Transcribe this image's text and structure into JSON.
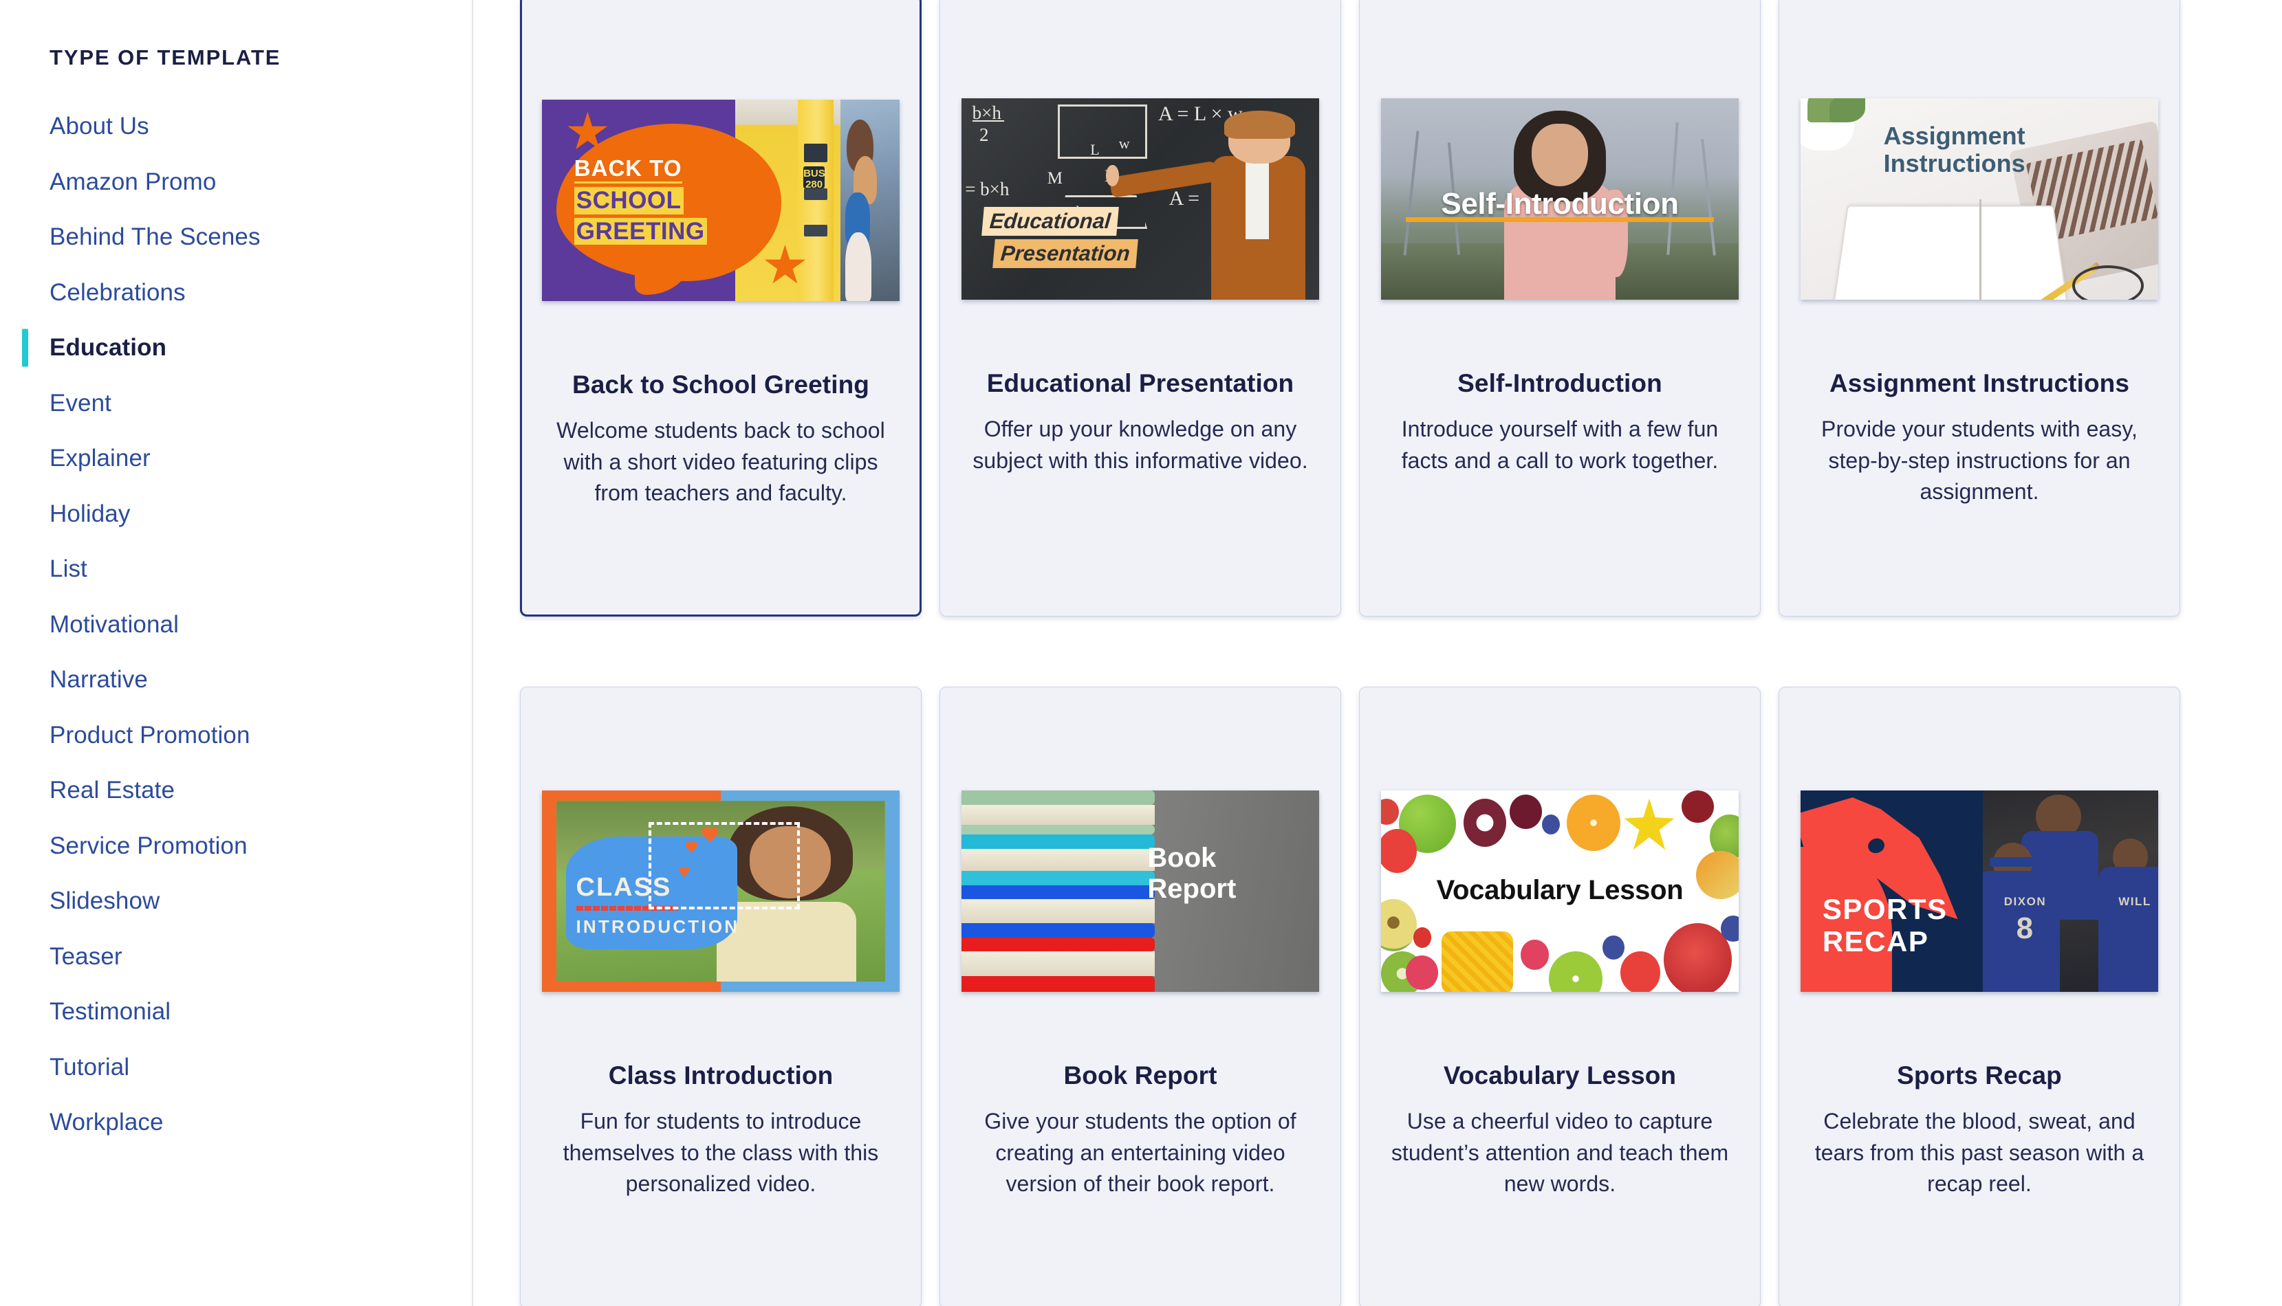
{
  "sidebar": {
    "title": "TYPE OF TEMPLATE",
    "items": [
      {
        "label": "About Us",
        "active": false
      },
      {
        "label": "Amazon Promo",
        "active": false
      },
      {
        "label": "Behind The Scenes",
        "active": false
      },
      {
        "label": "Celebrations",
        "active": false
      },
      {
        "label": "Education",
        "active": true
      },
      {
        "label": "Event",
        "active": false
      },
      {
        "label": "Explainer",
        "active": false
      },
      {
        "label": "Holiday",
        "active": false
      },
      {
        "label": "List",
        "active": false
      },
      {
        "label": "Motivational",
        "active": false
      },
      {
        "label": "Narrative",
        "active": false
      },
      {
        "label": "Product Promotion",
        "active": false
      },
      {
        "label": "Real Estate",
        "active": false
      },
      {
        "label": "Service Promotion",
        "active": false
      },
      {
        "label": "Slideshow",
        "active": false
      },
      {
        "label": "Teaser",
        "active": false
      },
      {
        "label": "Testimonial",
        "active": false
      },
      {
        "label": "Tutorial",
        "active": false
      },
      {
        "label": "Workplace",
        "active": false
      }
    ]
  },
  "colors": {
    "accent_teal": "#23c8d2",
    "link_blue": "#2c4b9b",
    "heading_navy": "#1b1f45",
    "card_bg": "#f0f2f8",
    "card_border": "#ccd3e8",
    "card_border_selected": "#24337e",
    "page_bg": "#ffffff"
  },
  "templates": [
    {
      "title": "Back to School Greeting",
      "description": "Welcome students back to school with a short video featuring clips from teachers and faculty.",
      "selected": true,
      "thumbnail_text": {
        "line1": "BACK TO",
        "line2": "SCHOOL",
        "line3": "GREETING",
        "bus_label": "BUS",
        "bus_number": "280"
      }
    },
    {
      "title": "Educational Presentation",
      "description": "Offer up your knowledge on any subject with this informative video.",
      "selected": false,
      "thumbnail_text": {
        "line1": "Educational",
        "line2": "Presentation",
        "chalk": [
          "b×h",
          "2",
          "= b×h",
          "M",
          "B",
          "E",
          "L",
          "w",
          "h",
          "A = L × w",
          "A ="
        ]
      }
    },
    {
      "title": "Self-Introduction",
      "description": "Introduce yourself with a few fun facts and a call to work together.",
      "selected": false,
      "thumbnail_text": {
        "line1": "Self-Introduction"
      }
    },
    {
      "title": "Assignment Instructions",
      "description": "Provide your students with easy, step-by-step instructions for an assignment.",
      "selected": false,
      "thumbnail_text": {
        "line1": "Assignment",
        "line2": "Instructions"
      }
    },
    {
      "title": "Class Introduction",
      "description": "Fun for students to introduce themselves to the class with this personalized video.",
      "selected": false,
      "thumbnail_text": {
        "line1": "CLASS",
        "line2": "INTRODUCTION"
      }
    },
    {
      "title": "Book Report",
      "description": "Give your students the option of creating an entertaining video version of their book report.",
      "selected": false,
      "thumbnail_text": {
        "line1": "Book",
        "line2": "Report"
      }
    },
    {
      "title": "Vocabulary Lesson",
      "description": "Use a cheerful video to capture student’s attention and teach them new words.",
      "selected": false,
      "thumbnail_text": {
        "line1": "Vocabulary Lesson"
      }
    },
    {
      "title": "Sports Recap",
      "description": "Celebrate the blood, sweat, and tears from this past season with a recap reel.",
      "selected": false,
      "thumbnail_text": {
        "line1": "SPORTS",
        "line2": "RECAP",
        "jersey_name": "DIXON",
        "jersey_number": "8",
        "jersey_name_2": "WILL"
      }
    }
  ]
}
